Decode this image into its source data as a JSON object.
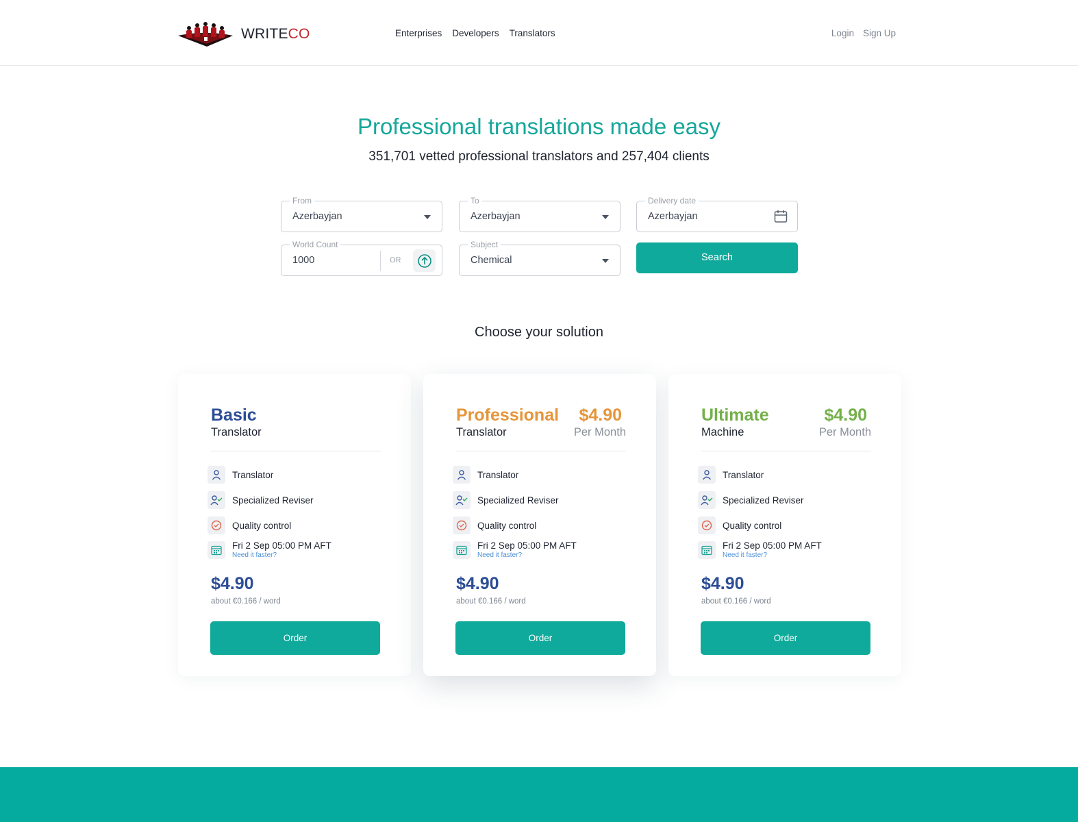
{
  "header": {
    "brand_main": "WRITE",
    "brand_accent": "CO",
    "nav": [
      "Enterprises",
      "Developers",
      "Translators"
    ],
    "login": "Login",
    "signup": "Sign Up"
  },
  "hero": {
    "title": "Professional translations made easy",
    "subtitle": "351,701 vetted professional translators and 257,404 clients"
  },
  "form": {
    "from": {
      "label": "From",
      "value": "Azerbayjan"
    },
    "to": {
      "label": "To",
      "value": "Azerbayjan"
    },
    "delivery": {
      "label": "Delivery date",
      "value": "Azerbayjan"
    },
    "word_count": {
      "label": "World Count",
      "value": "1000",
      "or": "OR"
    },
    "subject": {
      "label": "Subject",
      "value": "Chemical"
    },
    "search": "Search"
  },
  "choose": "Choose your solution",
  "cards": [
    {
      "name": "Basic",
      "type": "Translator",
      "price_top": "",
      "period": "",
      "color": "#2d4e96",
      "features": [
        "Translator",
        "Specialized Reviser",
        "Quality control"
      ],
      "date": "Fri 2 Sep 05:00 PM AFT",
      "faster": "Need it faster?",
      "price": "$4.90",
      "per_word": "about €0.166 / word",
      "order": "Order"
    },
    {
      "name": "Professional",
      "type": "Translator",
      "price_top": "$4.90",
      "period": "Per Month",
      "color": "#e6953a",
      "features": [
        "Translator",
        "Specialized Reviser",
        "Quality control"
      ],
      "date": "Fri 2 Sep 05:00 PM AFT",
      "faster": "Need it faster?",
      "price": "$4.90",
      "per_word": "about €0.166 / word",
      "order": "Order"
    },
    {
      "name": "Ultimate",
      "type": "Machine",
      "price_top": "$4.90",
      "period": "Per Month",
      "color": "#74b04a",
      "features": [
        "Translator",
        "Specialized Reviser",
        "Quality control"
      ],
      "date": "Fri 2 Sep 05:00 PM AFT",
      "faster": "Need it faster?",
      "price": "$4.90",
      "per_word": "about €0.166 / word",
      "order": "Order"
    }
  ],
  "colors": {
    "accent": "#0faa9b",
    "footer": "#05ab9e",
    "title": "#14a79a"
  }
}
